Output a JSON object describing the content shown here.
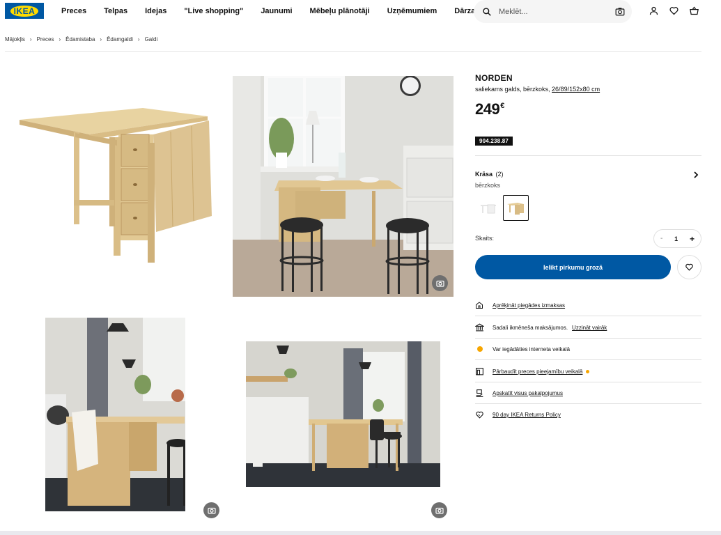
{
  "header": {
    "logo_text": "IKEA",
    "nav": [
      "Preces",
      "Telpas",
      "Idejas",
      "\"Live shopping\"",
      "Jaunumi",
      "Mēbeļu plānotāji",
      "Uzņēmumiem",
      "Dārza mēbeles"
    ],
    "search_placeholder": "Meklēt...",
    "icons": [
      "search-icon",
      "camera-icon",
      "user-icon",
      "heart-icon",
      "basket-icon"
    ]
  },
  "breadcrumb": [
    "Mājokļis",
    "Preces",
    "Ēdamistaba",
    "Ēdamgaldi",
    "Galdi"
  ],
  "product": {
    "name": "NORDEN",
    "desc_prefix": "saliekams galds, bērzkoks, ",
    "desc_dims": "26/89/152x80 cm",
    "price": "249",
    "currency": "€",
    "article_number": "904.238.87",
    "color_label": "Krāsa",
    "color_count": "(2)",
    "color_value": "bērzkoks",
    "qty_label": "Skaits:",
    "qty_minus": "-",
    "qty_value": "1",
    "qty_plus": "+",
    "cta": "Ielikt pirkumu grozā"
  },
  "info_rows": [
    {
      "icon": "home-icon",
      "text": "Aprēķināt piegādes izmaksas",
      "underline": true
    },
    {
      "icon": "bank-icon",
      "text": "Sadali ikmēneša maksājumos.",
      "link": "Uzzināt vairāk"
    },
    {
      "icon": "status-dot-icon",
      "text": "Var iegādāties interneta veikalā"
    },
    {
      "icon": "store-icon",
      "text": "Pārbaudīt preces pieejamību veikalā",
      "underline": true
    },
    {
      "icon": "service-icon",
      "text": "Apskatīt visus pakalpojumus",
      "underline": true
    },
    {
      "icon": "returns-icon",
      "text": "90 day IKEA Returns Policy",
      "underline": true
    }
  ],
  "colors": {
    "brand_blue": "#0058a3",
    "brand_yellow": "#ffdb00",
    "status_orange": "#f7a600"
  }
}
